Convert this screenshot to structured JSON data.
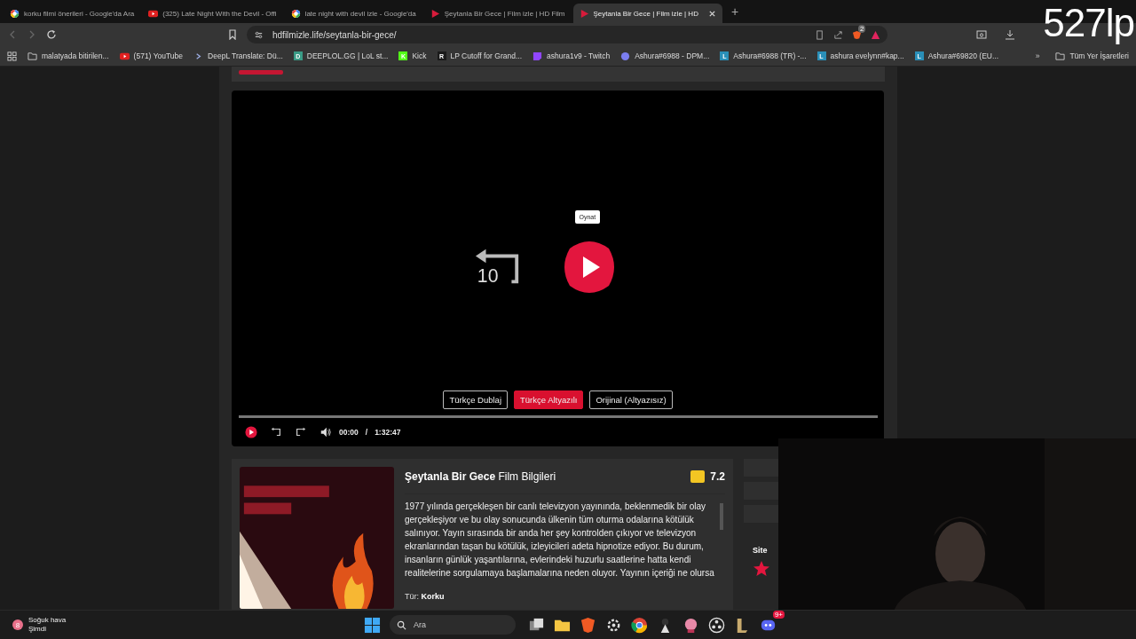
{
  "tabs": [
    {
      "title": "korku filmi önerileri - Google'da Ara",
      "kind": "google",
      "selected": false
    },
    {
      "title": "(325) Late Night With the Devil - Offi",
      "kind": "youtube",
      "selected": false
    },
    {
      "title": "late night with devil izle - Google'da",
      "kind": "google",
      "selected": false
    },
    {
      "title": "Şeytanla Bir Gece | Film izle | HD Film",
      "kind": "site",
      "selected": false
    },
    {
      "title": "Şeytanla Bir Gece | Film izle | HD",
      "kind": "site",
      "selected": true
    }
  ],
  "new_tab": "+",
  "address": "hdfilmizle.life/seytanla-bir-gece/",
  "bookmarks": [
    {
      "label": "malatyada bitirilen...",
      "kind": "folder"
    },
    {
      "label": "(571) YouTube",
      "kind": "youtube"
    },
    {
      "label": "DeepL Translate: Dü...",
      "kind": "chevron"
    },
    {
      "label": "DEEPLOL.GG | LoL st...",
      "kind": "letter",
      "glyph": "D",
      "color": "#3a9b86"
    },
    {
      "label": "Kick",
      "kind": "letter",
      "glyph": "K",
      "color": "#53fc18"
    },
    {
      "label": "LP Cutoff for Grand...",
      "kind": "letter",
      "glyph": "R",
      "color": "#1a1a1a"
    },
    {
      "label": "ashura1v9 - Twitch",
      "kind": "twitch"
    },
    {
      "label": "Ashura#6988 - DPM...",
      "kind": "dpm"
    },
    {
      "label": "Ashura#6988 (TR) -...",
      "kind": "letter",
      "glyph": "L",
      "color": "#2a8fb8"
    },
    {
      "label": "ashura evelynn#kap...",
      "kind": "letter",
      "glyph": "L",
      "color": "#2a8fb8"
    },
    {
      "label": "Ashura#69820 (EU...",
      "kind": "letter",
      "glyph": "L",
      "color": "#2a8fb8"
    }
  ],
  "more_bookmarks": "»",
  "all_bookmarks": "Tüm Yer İşaretleri",
  "shield_count": "2",
  "overlay_text": "527lp",
  "player": {
    "tooltip": "Oynat",
    "skip_seconds": "10",
    "languages": [
      {
        "label": "Türkçe Dublaj",
        "selected": false
      },
      {
        "label": "Türkçe Altyazılı",
        "selected": true
      },
      {
        "label": "Orijinal (Altyazısız)",
        "selected": false
      }
    ],
    "current_time": "00:00",
    "separator": "/",
    "duration": "1:32:47"
  },
  "movie": {
    "title": "Şeytanla Bir Gece",
    "title_suffix": "Film Bilgileri",
    "rating": "7.2",
    "description": "1977 yılında gerçekleşen bir canlı televizyon yayınında, beklenmedik bir olay gerçekleşiyor ve bu olay sonucunda ülkenin tüm oturma odalarına kötülük salınıyor. Yayın sırasında bir anda her şey kontrolden çıkıyor ve televizyon ekranlarından taşan bu kötülük, izleyicileri adeta hipnotize ediyor. Bu durum, insanların günlük yaşantılarına, evlerindeki huzurlu saatlerine hatta kendi realitelerine sorgulamaya başlamalarına neden oluyor. Yayının içeriği ne olursa",
    "genre_label": "Tür:",
    "genre": "Korku"
  },
  "sidebar_label": "Site",
  "taskbar": {
    "weather_temp": "8",
    "weather": "Soğuk hava",
    "weather_time": "Şimdi",
    "search_placeholder": "Ara",
    "chat_badge": "9+"
  }
}
